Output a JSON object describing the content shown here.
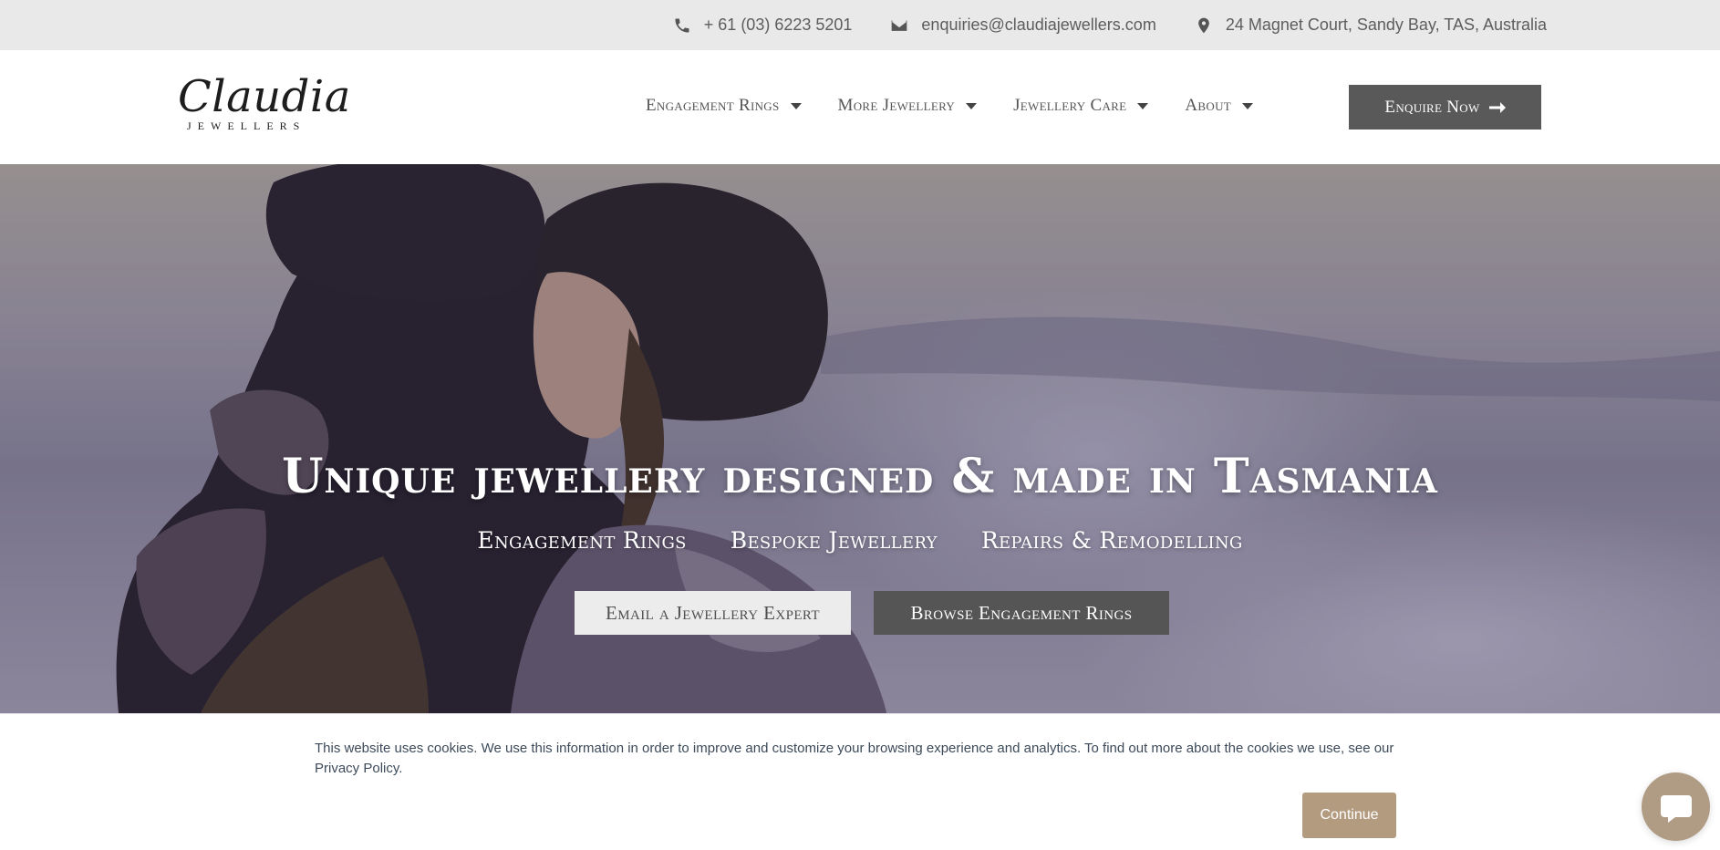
{
  "topbar": {
    "phone": "+ 61 (03) 6223 5201",
    "email": "enquiries@claudiajewellers.com",
    "address": "24 Magnet Court, Sandy Bay, TAS, Australia",
    "icons": [
      "phone-icon",
      "envelope-icon",
      "map-pin-icon"
    ]
  },
  "logo": {
    "main": "Claudia",
    "sub": "JEWELLERS"
  },
  "nav": {
    "items": [
      {
        "label": "Engagement Rings"
      },
      {
        "label": "More Jewellery"
      },
      {
        "label": "Jewellery Care"
      },
      {
        "label": "About"
      }
    ],
    "cta": "Enquire Now"
  },
  "hero": {
    "title": "Unique jewellery designed & made in Tasmania",
    "links": [
      "Engagement Rings",
      "Bespoke Jewellery",
      "Repairs & Remodelling"
    ],
    "btn_email": "Email a Jewellery Expert",
    "btn_browse": "Browse Engagement Rings"
  },
  "cookie": {
    "text": "This website uses cookies. We use this information in order to improve and customize your browsing experience and analytics. To find out more about the cookies we use, see our Privacy Policy.",
    "button": "Continue"
  },
  "colors": {
    "topbar_bg": "#e9e9ea",
    "button_dark": "#595959",
    "button_light": "#ececec",
    "cookie_button": "#b39b80",
    "chat_bubble": "#b09b85"
  }
}
